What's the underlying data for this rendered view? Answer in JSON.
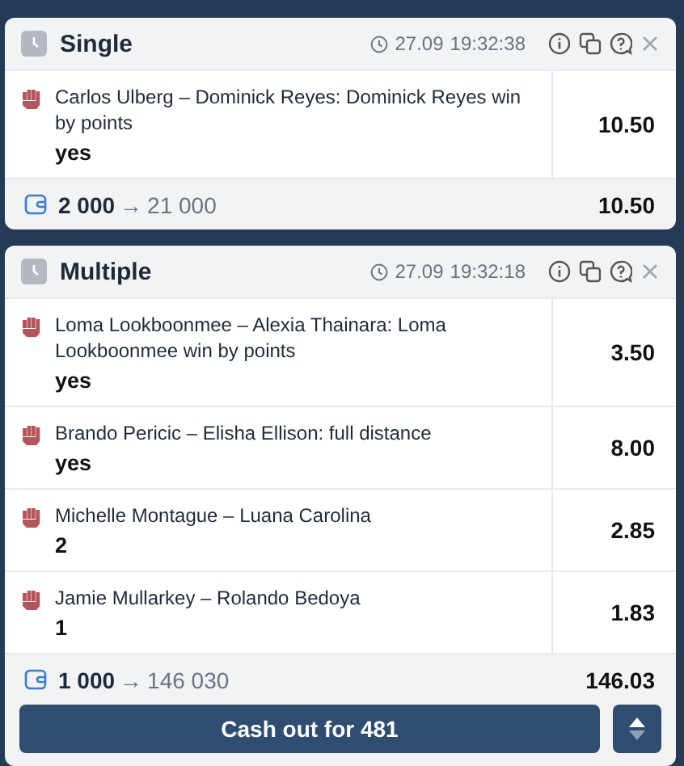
{
  "bets": [
    {
      "title": "Single",
      "date": "27.09",
      "time": "19:32:38",
      "events": [
        {
          "event": "Carlos Ulberg – Dominick Reyes: Dominick Reyes win by points",
          "outcome": "yes",
          "odds": "10.50"
        }
      ],
      "stake": "2 000",
      "arrow": "→",
      "payout": "21 000",
      "total_odds": "10.50"
    },
    {
      "title": "Multiple",
      "date": "27.09",
      "time": "19:32:18",
      "events": [
        {
          "event": "Loma Lookboonmee – Alexia Thainara: Loma Lookboonmee win by points",
          "outcome": "yes",
          "odds": "3.50"
        },
        {
          "event": "Brando Pericic – Elisha Ellison: full distance",
          "outcome": "yes",
          "odds": "8.00"
        },
        {
          "event": "Michelle Montague – Luana Carolina",
          "outcome": "2",
          "odds": "2.85"
        },
        {
          "event": "Jamie Mullarkey – Rolando Bedoya",
          "outcome": "1",
          "odds": "1.83"
        }
      ],
      "stake": "1 000",
      "arrow": "→",
      "payout": "146 030",
      "total_odds": "146.03",
      "cashout": "Cash out for 481"
    }
  ]
}
